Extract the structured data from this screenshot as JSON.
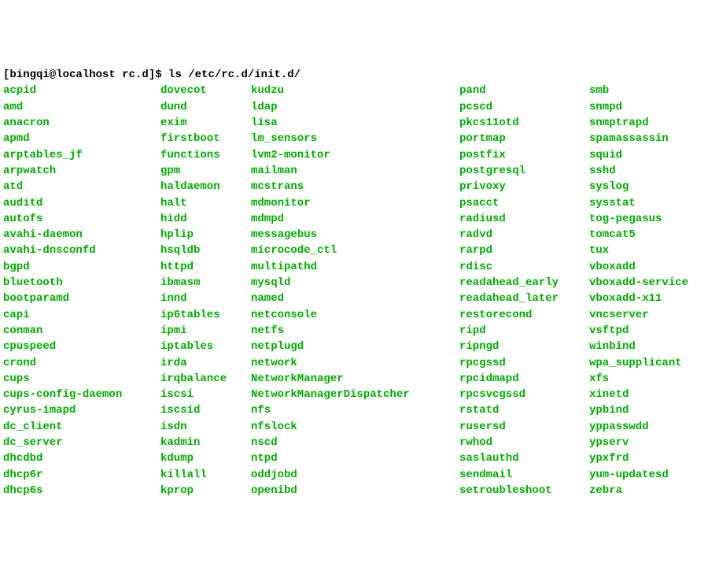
{
  "prompt": {
    "user_host": "[bingqi@localhost rc.d]$",
    "command": "ls /etc/rc.d/init.d/"
  },
  "columns": {
    "c1": [
      "acpid",
      "amd",
      "anacron",
      "apmd",
      "arptables_jf",
      "arpwatch",
      "atd",
      "auditd",
      "autofs",
      "avahi-daemon",
      "avahi-dnsconfd",
      "bgpd",
      "bluetooth",
      "bootparamd",
      "capi",
      "conman",
      "cpuspeed",
      "crond",
      "cups",
      "cups-config-daemon",
      "cyrus-imapd",
      "dc_client",
      "dc_server",
      "dhcdbd",
      "dhcp6r",
      "dhcp6s"
    ],
    "c2": [
      "dovecot",
      "dund",
      "exim",
      "firstboot",
      "functions",
      "gpm",
      "haldaemon",
      "halt",
      "hidd",
      "hplip",
      "hsqldb",
      "httpd",
      "ibmasm",
      "innd",
      "ip6tables",
      "ipmi",
      "iptables",
      "irda",
      "irqbalance",
      "iscsi",
      "iscsid",
      "isdn",
      "kadmin",
      "kdump",
      "killall",
      "kprop"
    ],
    "c3": [
      "kudzu",
      "ldap",
      "lisa",
      "lm_sensors",
      "lvm2-monitor",
      "mailman",
      "mcstrans",
      "mdmonitor",
      "mdmpd",
      "messagebus",
      "microcode_ctl",
      "multipathd",
      "mysqld",
      "named",
      "netconsole",
      "netfs",
      "netplugd",
      "network",
      "NetworkManager",
      "NetworkManagerDispatcher",
      "nfs",
      "nfslock",
      "nscd",
      "ntpd",
      "oddjobd",
      "openibd"
    ],
    "c4": [
      "pand",
      "pcscd",
      "pkcs11otd",
      "portmap",
      "postfix",
      "postgresql",
      "privoxy",
      "psacct",
      "radiusd",
      "radvd",
      "rarpd",
      "rdisc",
      "readahead_early",
      "readahead_later",
      "restorecond",
      "ripd",
      "ripngd",
      "rpcgssd",
      "rpcidmapd",
      "rpcsvcgssd",
      "rstatd",
      "rusersd",
      "rwhod",
      "saslauthd",
      "sendmail",
      "setroubleshoot"
    ],
    "c5": [
      "smb",
      "snmpd",
      "snmptrapd",
      "spamassassin",
      "squid",
      "sshd",
      "syslog",
      "sysstat",
      "tog-pegasus",
      "tomcat5",
      "tux",
      "vboxadd",
      "vboxadd-service",
      "vboxadd-x11",
      "vncserver",
      "vsftpd",
      "winbind",
      "wpa_supplicant",
      "xfs",
      "xinetd",
      "ypbind",
      "yppasswdd",
      "ypserv",
      "ypxfrd",
      "yum-updatesd",
      "zebra"
    ]
  }
}
